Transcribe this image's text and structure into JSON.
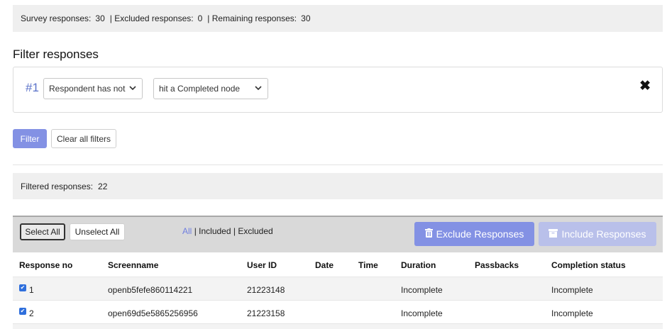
{
  "summary": {
    "survey_label": "Survey responses:",
    "survey_value": "30",
    "excluded_label": "| Excluded responses:",
    "excluded_value": "0",
    "remaining_label": "| Remaining responses:",
    "remaining_value": "30"
  },
  "filter": {
    "heading": "Filter responses",
    "index": "#1",
    "condition_selected": "Respondent has not",
    "target_selected": "hit a Completed node",
    "filter_button": "Filter",
    "clear_button": "Clear all filters"
  },
  "filtered": {
    "label": "Filtered responses:",
    "value": "22"
  },
  "toolbar": {
    "select_all": "Select All",
    "unselect_all": "Unselect All",
    "view_all": "All",
    "view_included": "Included",
    "view_excluded": "Excluded",
    "exclude_button": "Exclude Responses",
    "include_button": "Include Responses"
  },
  "table": {
    "headers": [
      "Response no",
      "Screenname",
      "User ID",
      "Date",
      "Time",
      "Duration",
      "Passbacks",
      "Completion status"
    ],
    "rows": [
      {
        "no": "1",
        "screenname": "openb5fefe860114221",
        "user_id": "21223148",
        "date": "",
        "time": "",
        "duration": "Incomplete",
        "passbacks": "",
        "status": "Incomplete",
        "checked": true
      },
      {
        "no": "2",
        "screenname": "open69d5e5865256956",
        "user_id": "21223158",
        "date": "",
        "time": "",
        "duration": "Incomplete",
        "passbacks": "",
        "status": "Incomplete",
        "checked": true
      }
    ]
  },
  "icons": {
    "close": "close-icon",
    "trash": "trash-icon",
    "archive": "archive-icon",
    "chevron": "chevron-down-icon"
  },
  "colors": {
    "accent": "#8391e4",
    "accent_disabled": "#b9c0ea",
    "index_blue": "#5b72c9",
    "panel_bg": "#efefef",
    "toolbar_bg": "#d9d9d9"
  }
}
